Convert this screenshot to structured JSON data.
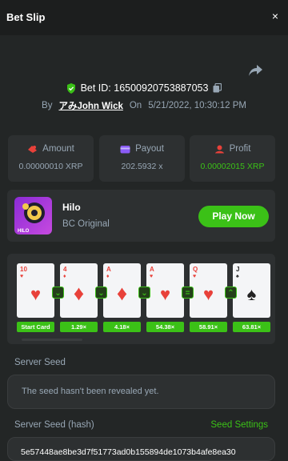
{
  "header": {
    "title": "Bet Slip",
    "close_icon": "×"
  },
  "bet": {
    "id_label": "Bet ID: 16500920753887053",
    "by_label": "By",
    "user": "アみJohn Wick",
    "on_label": "On",
    "timestamp": "5/21/2022, 10:30:12 PM"
  },
  "stats": {
    "amount": {
      "label": "Amount",
      "value": "0.00000010 XRP"
    },
    "payout": {
      "label": "Payout",
      "value": "202.5932 x"
    },
    "profit": {
      "label": "Profit",
      "value": "0.00002015 XRP"
    }
  },
  "game": {
    "name": "Hilo",
    "subtitle": "BC Original",
    "play_label": "Play Now",
    "thumb_text": "HILO"
  },
  "cards": [
    {
      "rank": "10",
      "suit": "♥",
      "multiplier": "Start Card",
      "arrow": ""
    },
    {
      "rank": "4",
      "suit": "♦",
      "multiplier": "1.29×",
      "arrow": "⌄"
    },
    {
      "rank": "A",
      "suit": "♦",
      "multiplier": "4.18×",
      "arrow": "⌄"
    },
    {
      "rank": "A",
      "suit": "♥",
      "multiplier": "54.38×",
      "arrow": "⌄"
    },
    {
      "rank": "Q",
      "suit": "♥",
      "multiplier": "58.91×",
      "arrow": "="
    },
    {
      "rank": "J",
      "suit": "♠",
      "multiplier": "63.81×",
      "arrow": "⌃"
    }
  ],
  "server_seed": {
    "label": "Server Seed",
    "value": "The seed hasn't been revealed yet."
  },
  "server_seed_hash": {
    "label": "Server Seed (hash)",
    "settings_label": "Seed Settings",
    "value": "5e57448ae8be3d7f51773ad0b155894de1073b4afe8ea30"
  },
  "colors": {
    "accent": "#3bc117",
    "background": "#232626",
    "panel": "#2d3031",
    "muted": "#98a7b5",
    "card_red": "#e8413a"
  }
}
